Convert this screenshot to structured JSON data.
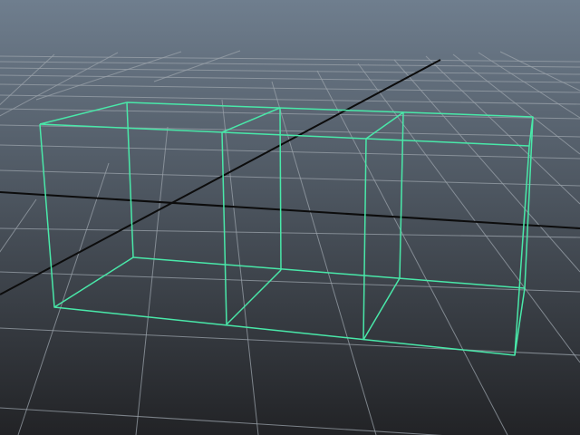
{
  "viewport": {
    "background_top": "#6f7e8e",
    "background_bottom": "#222326",
    "grid_color": "#9aa2a9",
    "axis_color": "#0c0c0c",
    "wireframe_color": "#49e8a9"
  },
  "scene": {
    "object_type": "box-wireframe",
    "subdivisions_width": 3,
    "subdivisions_height": 1,
    "subdivisions_depth": 1,
    "selected": true
  }
}
